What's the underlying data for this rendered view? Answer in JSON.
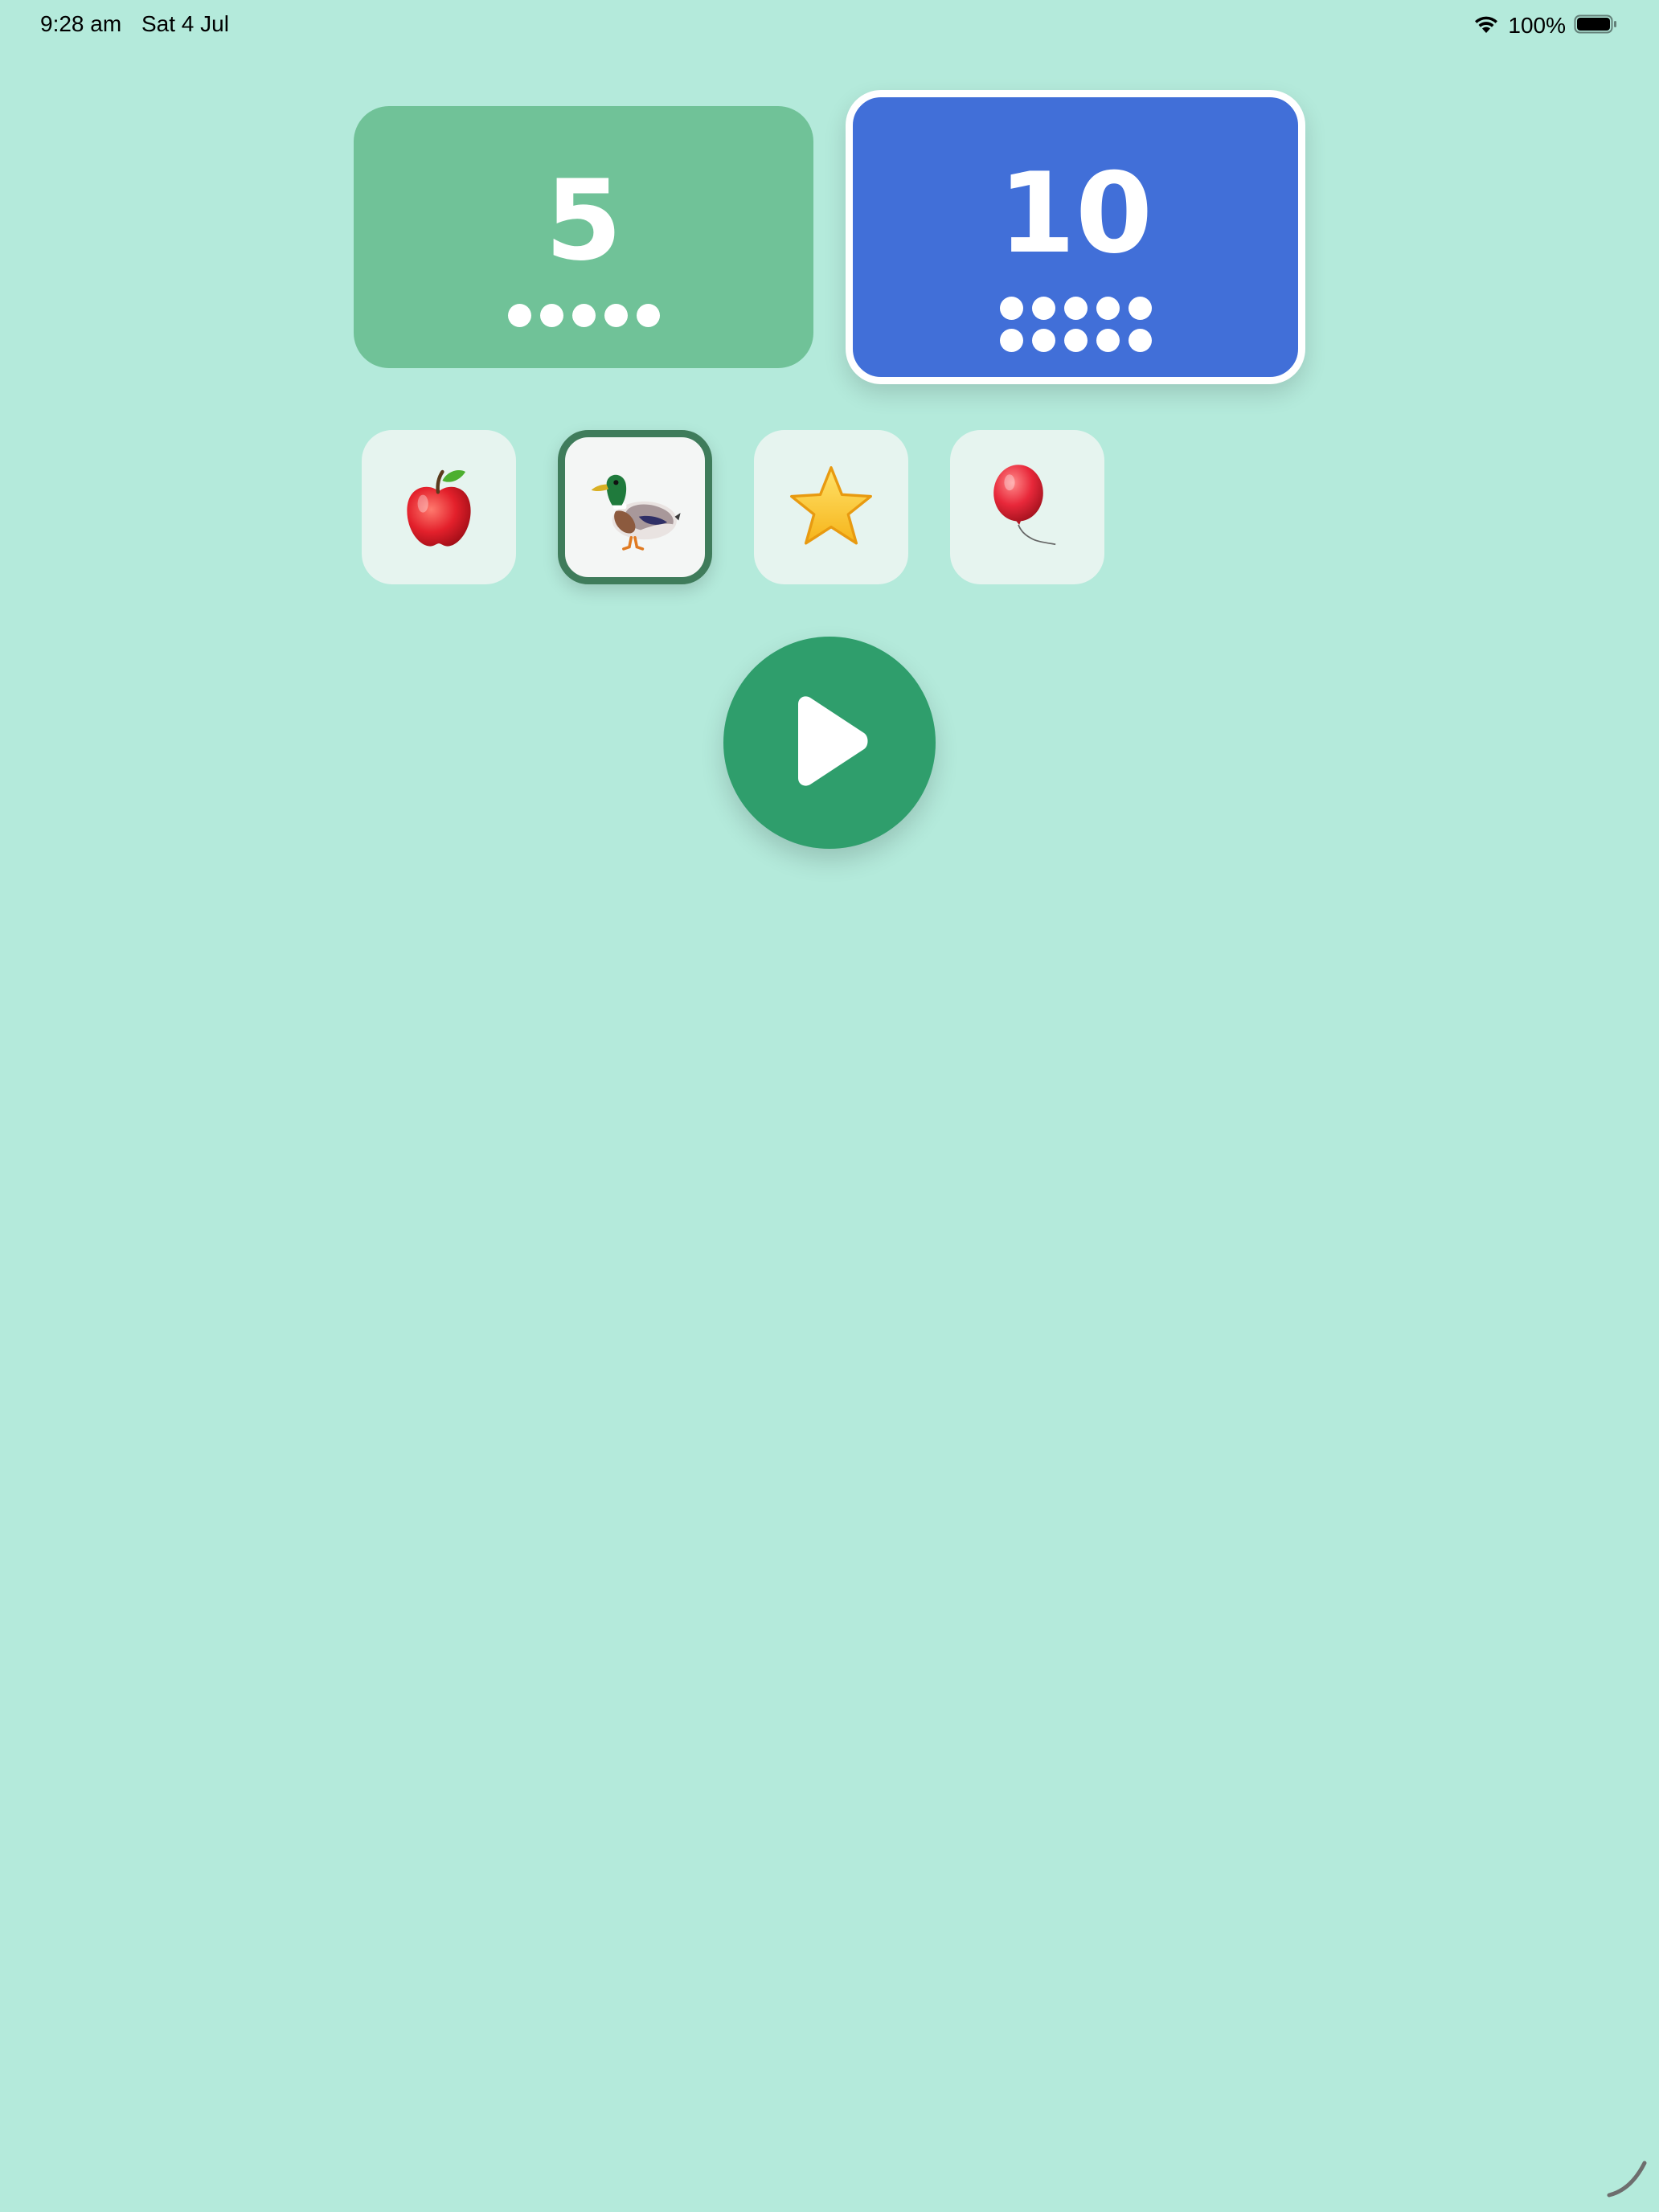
{
  "status_bar": {
    "time": "9:28 am",
    "date": "Sat 4 Jul",
    "battery": "100%"
  },
  "count_options": [
    {
      "label": "5",
      "dots": 5,
      "color": "#70c298",
      "selected": false
    },
    {
      "label": "10",
      "dots": 10,
      "color": "#416fd8",
      "selected": true
    }
  ],
  "objects": [
    {
      "icon": "apple-icon",
      "selected": false
    },
    {
      "icon": "duck-icon",
      "selected": true
    },
    {
      "icon": "star-icon",
      "selected": false
    },
    {
      "icon": "balloon-icon",
      "selected": false
    }
  ],
  "play_button": {
    "icon": "play-icon",
    "color": "#2f9e6c"
  },
  "colors": {
    "background": "#b4eadb",
    "selected_tile_border": "#3f7c5b"
  }
}
